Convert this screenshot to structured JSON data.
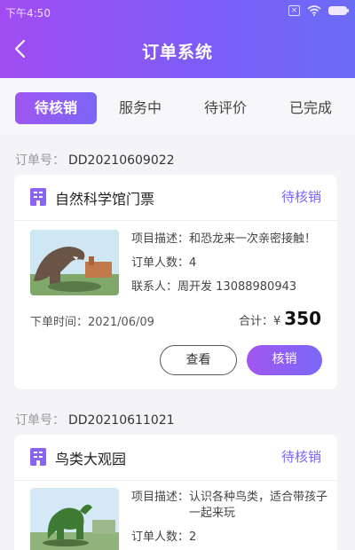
{
  "status_bar": {
    "time": "下午4:50",
    "sim_icon": "sim-x-icon",
    "wifi_icon": "wifi-icon",
    "battery_icon": "battery-icon"
  },
  "header": {
    "title": "订单系统",
    "back_icon": "chevron-left-icon"
  },
  "tabs": [
    {
      "label": "待核销",
      "active": true
    },
    {
      "label": "服务中",
      "active": false
    },
    {
      "label": "待评价",
      "active": false
    },
    {
      "label": "已完成",
      "active": false
    }
  ],
  "orders": [
    {
      "order_no_label": "订单号：",
      "order_no": "DD20210609022",
      "venue": "自然科学馆门票",
      "status": "待核销",
      "rows": [
        {
          "label": "项目描述：",
          "value": "和恐龙来一次亲密接触！"
        },
        {
          "label": "订单人数：",
          "value": "4"
        },
        {
          "label": "联系人：",
          "value": "周开发 13088980943"
        }
      ],
      "order_time_label": "下单时间：",
      "order_time": "2021/06/09",
      "total_label": "合计：¥",
      "total": "350",
      "view_button": "查看",
      "verify_button": "核销"
    },
    {
      "order_no_label": "订单号：",
      "order_no": "DD20210611021",
      "venue": "鸟类大观园",
      "status": "待核销",
      "rows": [
        {
          "label": "项目描述：",
          "value": "认识各种鸟类，适合带孩子一起来玩"
        },
        {
          "label": "订单人数：",
          "value": "2"
        }
      ]
    }
  ],
  "colors": {
    "accent": "#7b66f5",
    "header_start": "#a14cf2",
    "header_end": "#6b6cf7"
  }
}
